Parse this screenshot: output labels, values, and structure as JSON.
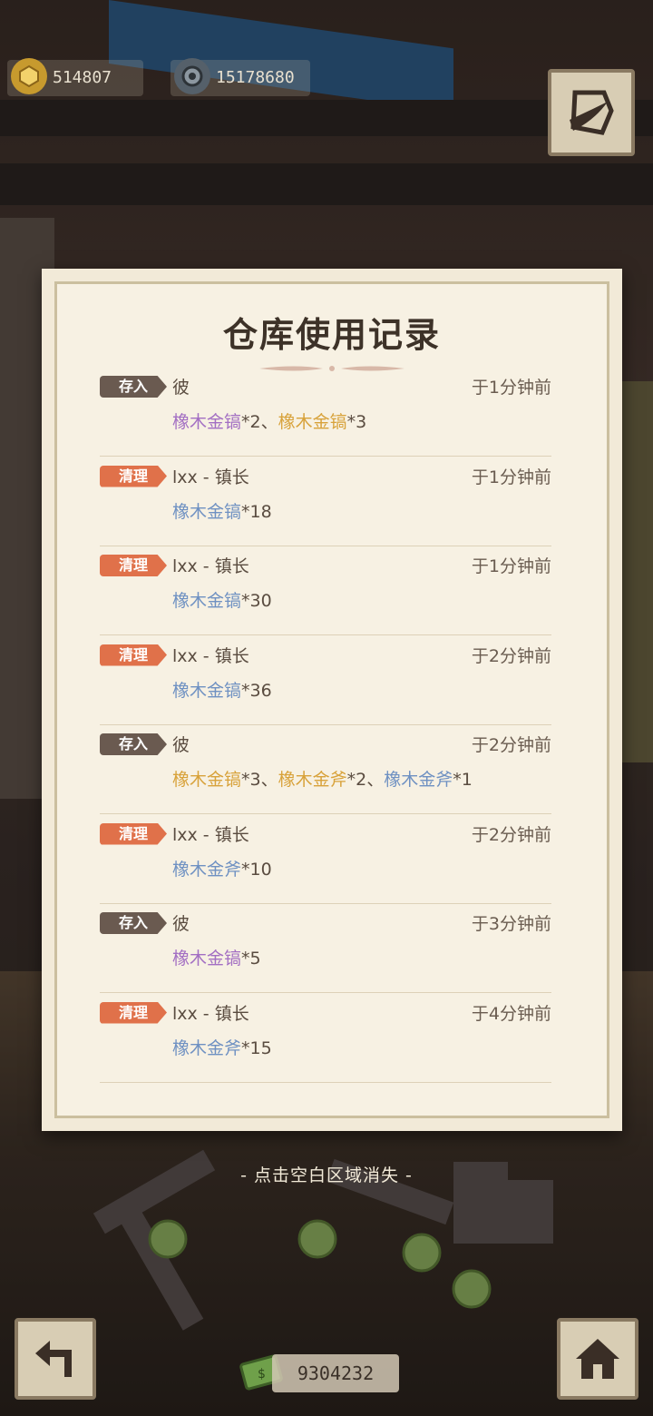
{
  "currencies": {
    "medal_amount": "514807",
    "gear_amount": "15178680",
    "bottom_amount": "9304232"
  },
  "panel": {
    "title": "仓库使用记录",
    "hint": "- 点击空白区域消失 -"
  },
  "records": [
    {
      "type": "存入",
      "kind": "store",
      "who": "彼",
      "when": "于1分钟前",
      "items": [
        {
          "name": "橡木金镐",
          "qty": "*2",
          "color": "purple",
          "sep": "、"
        },
        {
          "name": "橡木金镐",
          "qty": "*3",
          "color": "gold",
          "sep": ""
        }
      ]
    },
    {
      "type": "清理",
      "kind": "clear",
      "who": "lxx - 镇长",
      "when": "于1分钟前",
      "items": [
        {
          "name": "橡木金镐",
          "qty": "*18",
          "color": "blue",
          "sep": ""
        }
      ]
    },
    {
      "type": "清理",
      "kind": "clear",
      "who": "lxx - 镇长",
      "when": "于1分钟前",
      "items": [
        {
          "name": "橡木金镐",
          "qty": "*30",
          "color": "blue",
          "sep": ""
        }
      ]
    },
    {
      "type": "清理",
      "kind": "clear",
      "who": "lxx - 镇长",
      "when": "于2分钟前",
      "items": [
        {
          "name": "橡木金镐",
          "qty": "*36",
          "color": "blue",
          "sep": ""
        }
      ]
    },
    {
      "type": "存入",
      "kind": "store",
      "who": "彼",
      "when": "于2分钟前",
      "items": [
        {
          "name": "橡木金镐",
          "qty": "*3",
          "color": "gold",
          "sep": "、"
        },
        {
          "name": "橡木金斧",
          "qty": "*2",
          "color": "gold",
          "sep": "、"
        },
        {
          "name": "橡木金斧",
          "qty": "*1",
          "color": "blue",
          "sep": ""
        }
      ]
    },
    {
      "type": "清理",
      "kind": "clear",
      "who": "lxx - 镇长",
      "when": "于2分钟前",
      "items": [
        {
          "name": "橡木金斧",
          "qty": "*10",
          "color": "blue",
          "sep": ""
        }
      ]
    },
    {
      "type": "存入",
      "kind": "store",
      "who": "彼",
      "when": "于3分钟前",
      "items": [
        {
          "name": "橡木金镐",
          "qty": "*5",
          "color": "purple",
          "sep": ""
        }
      ]
    },
    {
      "type": "清理",
      "kind": "clear",
      "who": "lxx - 镇长",
      "when": "于4分钟前",
      "items": [
        {
          "name": "橡木金斧",
          "qty": "*15",
          "color": "blue",
          "sep": ""
        }
      ]
    }
  ],
  "icons": {
    "top_left": "medal-icon",
    "top_second": "gear-coin-icon",
    "top_right": "journal-quill-icon",
    "bottom_left": "back-arrow-icon",
    "bottom_right": "home-icon",
    "bottom_center": "cash-icon"
  }
}
